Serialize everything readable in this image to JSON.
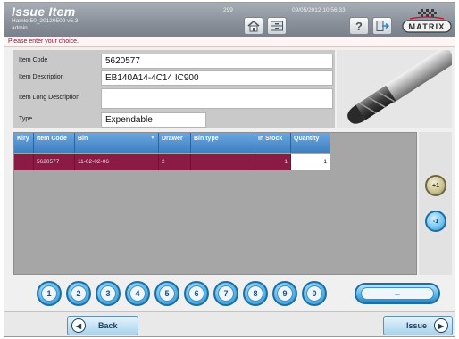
{
  "header": {
    "title": "Issue Item",
    "subtitle_line1": "Hamlet50_20120509 v5.3",
    "subtitle_line2": "admin",
    "station_number": "299",
    "datetime": "09/05/2012 10:56:33",
    "logo_text": "MATRIX"
  },
  "prompt": "Please enter your choice.",
  "item": {
    "code_label": "Item Code",
    "code_value": "5620577",
    "desc_label": "Item Description",
    "desc_value": "EB140A14-4C14     IC900",
    "long_desc_label": "Item Long Description",
    "long_desc_value": "",
    "type_label": "Type",
    "type_value": "Expendable"
  },
  "table": {
    "headers": [
      "Kiry",
      "Item Code",
      "Bin",
      "Drawer",
      "Bin type",
      "In Stock",
      "Quantity"
    ],
    "rows": [
      {
        "kiry": "",
        "item_code": "5620577",
        "bin": "11-02-02-06",
        "drawer": "2",
        "bin_type": "",
        "in_stock": "1",
        "quantity": "1"
      }
    ]
  },
  "side_buttons": {
    "plus_one": "+1",
    "minus_one": "-1"
  },
  "keypad": {
    "keys": [
      "1",
      "2",
      "3",
      "4",
      "5",
      "6",
      "7",
      "8",
      "9",
      "0"
    ],
    "backspace": "←"
  },
  "nav": {
    "back_label": "Back",
    "issue_label": "Issue"
  },
  "colors": {
    "accent": "#5db7ea",
    "selected_row": "#8b1a44",
    "header_blue": "#3f7fc0"
  }
}
